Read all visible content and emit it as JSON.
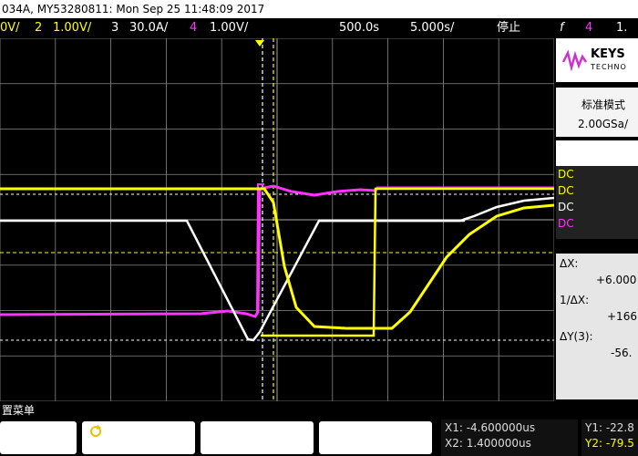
{
  "header": {
    "info": "034A, MY53280811: Mon Sep 25 11:48:09 2017"
  },
  "channels": {
    "ch1_scale": "0V/",
    "ch2_num": "2",
    "ch2_scale": "1.00V/",
    "ch3_num": "3",
    "ch3_scale": "30.0A/",
    "ch4_num": "4",
    "ch4_scale": "1.00V/",
    "timebase": "500.0s",
    "delay": "5.000s/",
    "run_state": "停止",
    "trigger_symbol": "f",
    "trigger_channel": "4",
    "trigger_level": "1."
  },
  "sidebar": {
    "brand_line1": "KEYS",
    "brand_line2": "TECHNO",
    "mode_label": "标准模式",
    "sample_rate": "2.00GSa/",
    "dc_labels": [
      "DC",
      "DC",
      "DC",
      "DC"
    ],
    "delta_x_label": "ΔX:",
    "delta_x_value": "+6.000",
    "inv_delta_x_label": "1/ΔX:",
    "inv_delta_x_value": "+166",
    "delta_y_label": "ΔY(3):",
    "delta_y_value": "-56."
  },
  "menu": {
    "title": "置菜单",
    "x1": "X1: -4.600000us",
    "x2": "X2: 1.400000us",
    "y1": "Y1: -22.8",
    "y2": "Y2: -79.5"
  },
  "colors": {
    "ch1": "#ffff00",
    "ch3": "#ffffff",
    "ch4": "#ff33ff",
    "grid": "#888888",
    "brand": "#cc33cc"
  },
  "icons": {
    "softkey2": "rotate-knob-icon",
    "logo": "keysight-wave-icon"
  }
}
